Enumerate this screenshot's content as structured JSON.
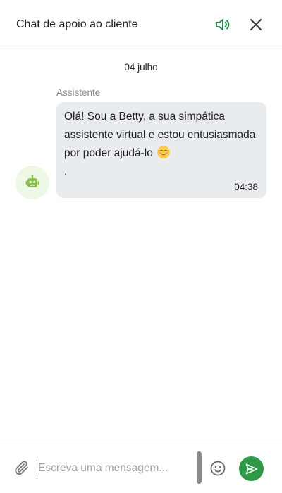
{
  "header": {
    "title": "Chat de apoio ao cliente",
    "speaker_icon": "speaker-icon",
    "close_icon": "close-icon"
  },
  "conversation": {
    "date": "04 julho",
    "messages": [
      {
        "sender": "Assistente",
        "text": "Olá! Sou a Betty, a sua simpática assistente virtual e estou entusiasmada por poder ajudá-lo",
        "emoji": "smiling-face-emoji",
        "text_after_emoji": ".",
        "time": "04:38",
        "avatar_icon": "robot-icon"
      }
    ]
  },
  "composer": {
    "placeholder": "Escreva uma mensagem...",
    "value": "",
    "attach_icon": "paperclip-icon",
    "emoji_icon": "smiley-icon",
    "send_icon": "send-icon"
  },
  "colors": {
    "accent": "#2e9a47",
    "bubble_bg": "#e9ecef",
    "avatar_bg": "#eef8e4",
    "robot": "#8bc34a"
  }
}
